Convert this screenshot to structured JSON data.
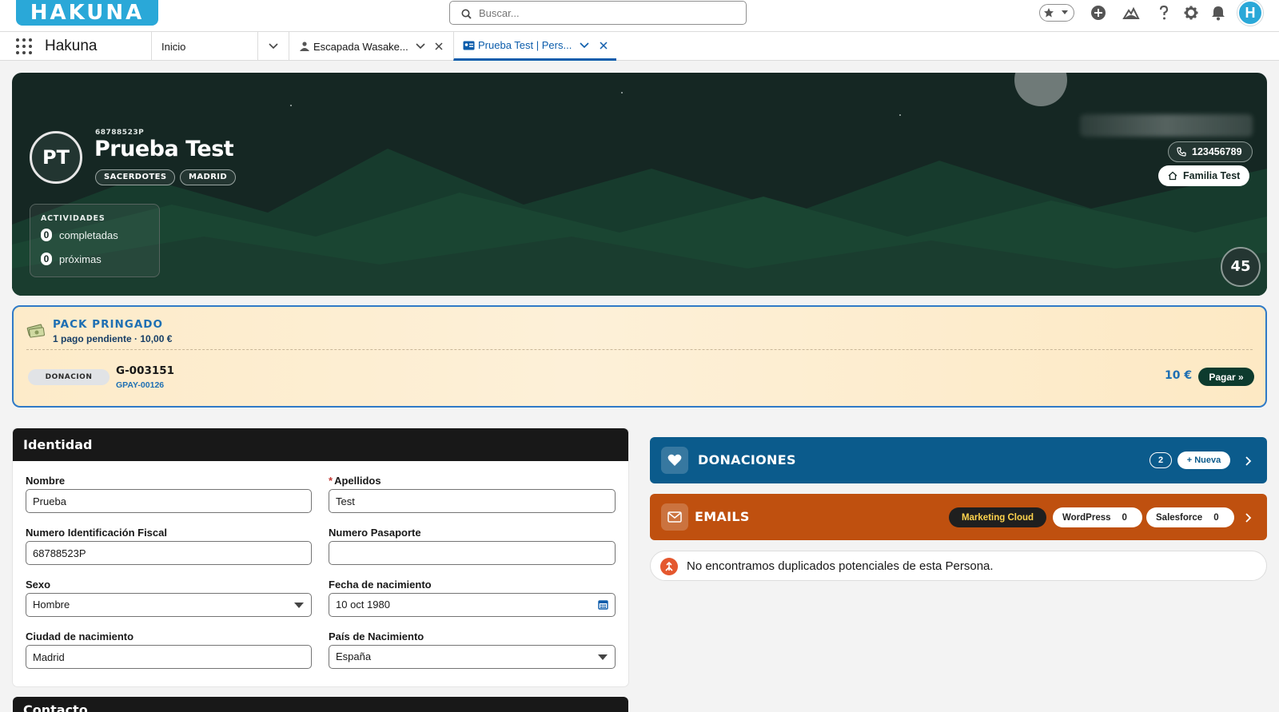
{
  "header": {
    "logo": "HAKUNA",
    "search_placeholder": "Buscar...",
    "avatar_initial": "H",
    "icons": [
      "star-icon",
      "chevron-down-icon",
      "add-icon",
      "trailhead-icon",
      "help-icon",
      "gear-icon",
      "bell-icon"
    ]
  },
  "nav": {
    "app_name": "Hakuna",
    "tabs": [
      {
        "label": "Inicio",
        "icon": "none",
        "closable": false,
        "active": false
      },
      {
        "label": "Escapada Wasake...",
        "icon": "campaign-icon",
        "closable": true,
        "active": false
      },
      {
        "label": "Prueba Test | Pers...",
        "icon": "contact-card-icon",
        "closable": true,
        "active": true
      }
    ]
  },
  "hero": {
    "initials": "PT",
    "document_id": "68788523P",
    "name": "Prueba Test",
    "badges": [
      "SACERDOTES",
      "MADRID"
    ],
    "activities": {
      "title": "ACTIVIDADES",
      "completed_count": "0",
      "completed_label": "completadas",
      "upcoming_count": "0",
      "upcoming_label": "próximas"
    },
    "phone": "123456789",
    "family": "Familia Test",
    "score": "45",
    "colors": {
      "background": "#152723",
      "mountains": "#1c4a36"
    }
  },
  "pack": {
    "title": "PACK PRINGADO",
    "subtitle": "1 pago pendiente · 10,00 €",
    "payment": {
      "type": "DONACION",
      "code": "G-003151",
      "ref": "GPAY-00126",
      "amount": "10 €",
      "pay_label": "Pagar »"
    },
    "colors": {
      "border": "#2f7ac7",
      "background": "#fdebc9"
    }
  },
  "identity": {
    "title": "Identidad",
    "fields": {
      "nombre": {
        "label": "Nombre",
        "value": "Prueba"
      },
      "apellidos": {
        "label": "Apellidos",
        "value": "Test",
        "required": "*"
      },
      "nif": {
        "label": "Numero Identificación Fiscal",
        "value": "68788523P"
      },
      "pasaporte": {
        "label": "Numero Pasaporte",
        "value": ""
      },
      "sexo": {
        "label": "Sexo",
        "value": "Hombre"
      },
      "nacimiento": {
        "label": "Fecha de nacimiento",
        "value": "10 oct 1980"
      },
      "ciudad": {
        "label": "Ciudad de nacimiento",
        "value": "Madrid"
      },
      "pais": {
        "label": "País de Nacimiento",
        "value": "España"
      }
    }
  },
  "contact": {
    "title": "Contacto"
  },
  "donations": {
    "title": "DONACIONES",
    "count": "2",
    "new_label": "+ Nueva",
    "color": "#0b5b8c"
  },
  "emails": {
    "title": "EMAILS",
    "color": "#bf500f",
    "sources": [
      {
        "name": "Marketing Cloud",
        "count": ""
      },
      {
        "name": "WordPress",
        "count": "0"
      },
      {
        "name": "Salesforce",
        "count": "0"
      }
    ]
  },
  "duplicates": {
    "message": "No encontramos duplicados potenciales de esta Persona."
  }
}
